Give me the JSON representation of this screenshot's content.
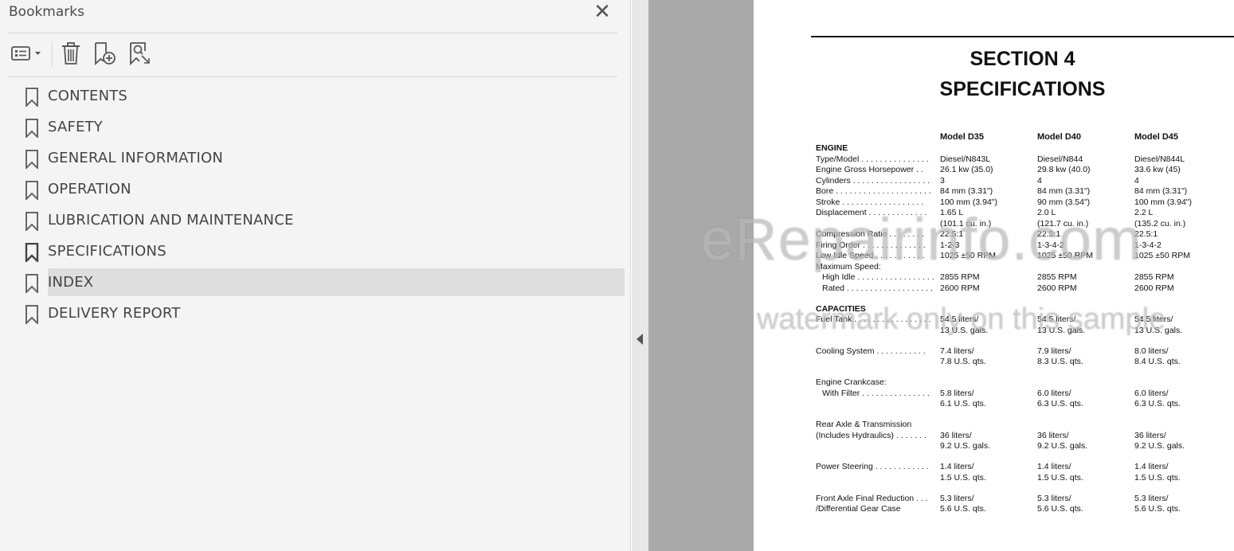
{
  "bookmarks_panel": {
    "title": "Bookmarks",
    "close_glyph": "✕",
    "toolbar": {
      "options_icon": "options-list-icon",
      "delete_icon": "trash-icon",
      "new_bookmark_icon": "add-bookmark-icon",
      "find_bookmark_icon": "search-bookmark-icon"
    },
    "items": [
      {
        "label": "CONTENTS"
      },
      {
        "label": "SAFETY"
      },
      {
        "label": "GENERAL INFORMATION"
      },
      {
        "label": "OPERATION"
      },
      {
        "label": "LUBRICATION AND MAINTENANCE"
      },
      {
        "label": "SPECIFICATIONS"
      },
      {
        "label": "INDEX",
        "selected": true
      },
      {
        "label": "DELIVERY REPORT"
      }
    ]
  },
  "document": {
    "section_line1": "SECTION 4",
    "section_line2": "SPECIFICATIONS",
    "columns": [
      "Model D35",
      "Model D40",
      "Model D45"
    ],
    "rows": [
      {
        "label": "ENGINE",
        "bold": true
      },
      {
        "label": "Type/Model . . . . . . . . . . . . . . .",
        "v": [
          "Diesel/N843L",
          "Diesel/N844",
          "Diesel/N844L"
        ]
      },
      {
        "label": "Engine Gross Horsepower . .",
        "v": [
          "26.1 kw (35.0)",
          "29.8 kw (40.0)",
          "33.6 kw (45)"
        ]
      },
      {
        "label": "Cylinders . . . . . . . . . . . . . . . . .",
        "v": [
          "3",
          "4",
          "4"
        ]
      },
      {
        "label": "Bore . . . . . . . . . . . . . . . . . . . . .",
        "v": [
          "84 mm (3.31\")",
          "84 mm (3.31\")",
          "84 mm (3.31\")"
        ]
      },
      {
        "label": "Stroke  . . . . . . . . . . . . . . . . . .",
        "v": [
          "100 mm (3.94\")",
          "90 mm (3.54\")",
          "100 mm (3.94\")"
        ]
      },
      {
        "label": "Displacement  . . . . . . . . . . . . .",
        "v": [
          "1.65 L",
          "2.0 L",
          "2.2 L"
        ]
      },
      {
        "label": "",
        "v": [
          "(101.1 cu. in.)",
          "(121.7 cu. in.)",
          "(135.2 cu. in.)"
        ]
      },
      {
        "label": "Compression Ratio  . . . . . . . .",
        "v": [
          "22.5:1",
          "22.5:1",
          "22.5:1"
        ]
      },
      {
        "label": "Firing Order  . . . . . . . . . . . . . .",
        "v": [
          "1-2-3",
          "1-3-4-2",
          "1-3-4-2"
        ]
      },
      {
        "label": "Low Idle Speed  . . . . . . . . . . .",
        "v": [
          "1025 ±50 RPM",
          "1025 ±50 RPM",
          "1025 ±50 RPM"
        ]
      },
      {
        "label": "Maximum Speed:"
      },
      {
        "label": "High Idle . . . . . . . . . . . . . . . . .",
        "indent": true,
        "v": [
          "2855 RPM",
          "2855 RPM",
          "2855 RPM"
        ]
      },
      {
        "label": "Rated  . . . . . . . . . . . . . . . . . . .",
        "indent": true,
        "v": [
          "2600 RPM",
          "2600 RPM",
          "2600 RPM"
        ]
      },
      {
        "label": "CAPACITIES",
        "bold": true,
        "gap": true
      },
      {
        "label": "Fuel Tank . . . . . . . . . . . . . . . . .",
        "v": [
          "54.5 liters/",
          "54.5 liters/",
          "54.5 liters/"
        ]
      },
      {
        "label": "",
        "v": [
          "13 U.S. gals.",
          "13 U.S. gals.",
          "13 U.S. gals."
        ]
      },
      {
        "label": "Cooling System  . . . . . . . . . . .",
        "gap": true,
        "v": [
          "7.4 liters/",
          "7.9 liters/",
          "8.0 liters/"
        ]
      },
      {
        "label": "",
        "v": [
          "7.8 U.S. qts.",
          "8.3 U.S. qts.",
          "8.4 U.S. qts."
        ]
      },
      {
        "label": "Engine Crankcase:",
        "gap": true
      },
      {
        "label": "With Filter . . . . . . . . . . . . . . .",
        "indent": true,
        "v": [
          "5.8 liters/",
          "6.0 liters/",
          "6.0 liters/"
        ]
      },
      {
        "label": "",
        "v": [
          "6.1 U.S. qts.",
          "6.3 U.S. qts.",
          "6.3 U.S. qts."
        ]
      },
      {
        "label": "Rear Axle & Transmission",
        "gap": true
      },
      {
        "label": "(Includes Hydraulics) . . . . . . .",
        "v": [
          "36 liters/",
          "36 liters/",
          "36 liters/"
        ]
      },
      {
        "label": "",
        "v": [
          "9.2 U.S. gals.",
          "9.2 U.S. gals.",
          "9.2 U.S. gals."
        ]
      },
      {
        "label": "Power Steering . . . . . . . . . . . .",
        "gap": true,
        "v": [
          "1.4 liters/",
          "1.4 liters/",
          "1.4 liters/"
        ]
      },
      {
        "label": "",
        "v": [
          "1.5 U.S. qts.",
          "1.5 U.S. qts.",
          "1.5 U.S. qts."
        ]
      },
      {
        "label": "Front Axle Final Reduction . . .",
        "gap": true,
        "v": [
          "5.3 liters/",
          "5.3 liters/",
          "5.3 liters/"
        ]
      },
      {
        "label": "/Differential Gear Case",
        "v": [
          "5.6 U.S. qts.",
          "5.6 U.S. qts.",
          "5.6 U.S. qts."
        ]
      }
    ],
    "watermark_line1": "eRepairinfo.com",
    "watermark_line2": "watermark only on this sample"
  }
}
